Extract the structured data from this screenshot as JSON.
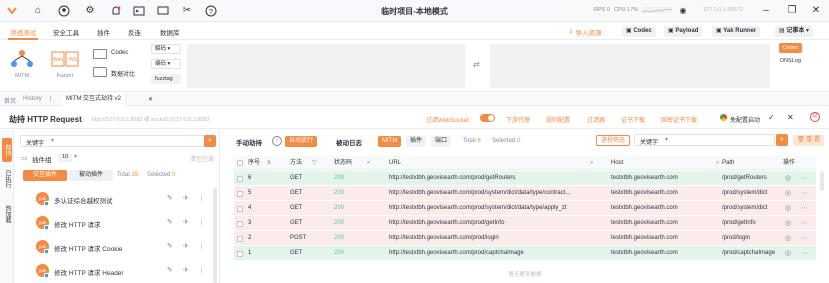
{
  "app": {
    "title": "临时项目-本地模式",
    "rps": "RPS 0",
    "cpu": "CPU 17%",
    "host": "127.0.0.1:55672"
  },
  "topnav": {
    "tabs": [
      "渗透测试",
      "安全工具",
      "插件",
      "反连",
      "数据库"
    ],
    "import": "导入资源",
    "buttons": [
      "Codec",
      "Payload",
      "Yak Runner",
      "记事本"
    ]
  },
  "ribbon": {
    "mitm": "MITM",
    "fuzzer": "Fuzzer",
    "codec": "Codec",
    "compare": "数据对比",
    "sel1": "解码",
    "sel2": "编码",
    "fuzztag": "fuzztag",
    "codec_btn": "Codec",
    "dnslog": "DNSLog"
  },
  "tabsbar": {
    "home": "首页",
    "history": "History",
    "mitm_tab": "MITM 交互式劫持 v2"
  },
  "hijack": {
    "title": "劫持 HTTP Request",
    "addr": "http://127.0.0.1:8083 或 socks5://127.0.0.1:8083",
    "websocket": "过滤WebSocket:",
    "links": [
      "下游代理",
      "规则配置",
      "过滤器",
      "证书下载",
      "国密证书下载"
    ],
    "exempt": "免配置启动"
  },
  "leftstrip": [
    "劫持",
    "已执行",
    "热加载"
  ],
  "plugins": {
    "keyword_label": "关键字",
    "group": "插件组",
    "group_count": "10",
    "clear": "清空已选",
    "tab_interactive": "交互插件",
    "tab_passive": "被动插件",
    "total_label": "Total",
    "total": "15",
    "selected_label": "Selected",
    "selected": "0",
    "items": [
      "多认证综合越权测试",
      "修改 HTTP 请求",
      "修改 HTTP 请求 Cookie",
      "修改 HTTP 请求 Header"
    ]
  },
  "table": {
    "manual": "手动劫持",
    "auto": "自动放行",
    "log": "被动日志",
    "mitm": "MITM",
    "plugin": "插件",
    "port": "端口",
    "total_label": "Total",
    "total": "6",
    "selected_label": "Selected",
    "selected": "0",
    "filter": "进程筛选",
    "keyword": "关键字",
    "reset": "重 置",
    "headers": [
      "序号",
      "方法",
      "状态码",
      "URL",
      "Host",
      "Path",
      "操作"
    ],
    "rows": [
      {
        "no": "6",
        "method": "GET",
        "status": "200",
        "url": "http://testxtbh.geovisearth.com/prod/getRouters",
        "host": "testxtbh.geovisearth.com",
        "path": "/prod/getRouters",
        "color": "green"
      },
      {
        "no": "5",
        "method": "GET",
        "status": "200",
        "url": "http://testxtbh.geovisearth.com/prod/system/dict/data/type/contract...",
        "host": "testxtbh.geovisearth.com",
        "path": "/prod/system/dict",
        "color": "red"
      },
      {
        "no": "4",
        "method": "GET",
        "status": "200",
        "url": "http://testxtbh.geovisearth.com/prod/system/dict/data/type/apply_zt",
        "host": "testxtbh.geovisearth.com",
        "path": "/prod/system/dict",
        "color": "red"
      },
      {
        "no": "3",
        "method": "GET",
        "status": "200",
        "url": "http://testxtbh.geovisearth.com/prod/getInfo",
        "host": "testxtbh.geovisearth.com",
        "path": "/prod/getInfo",
        "color": "red"
      },
      {
        "no": "2",
        "method": "POST",
        "status": "200",
        "url": "http://testxtbh.geovisearth.com/prod/login",
        "host": "testxtbh.geovisearth.com",
        "path": "/prod/login",
        "color": "red"
      },
      {
        "no": "1",
        "method": "GET",
        "status": "200",
        "url": "http://testxtbh.geovisearth.com/prod/captchaImage",
        "host": "testxtbh.geovisearth.com",
        "path": "/prod/captchaImage",
        "color": "green"
      }
    ],
    "no_more": "暂无更多数据"
  }
}
